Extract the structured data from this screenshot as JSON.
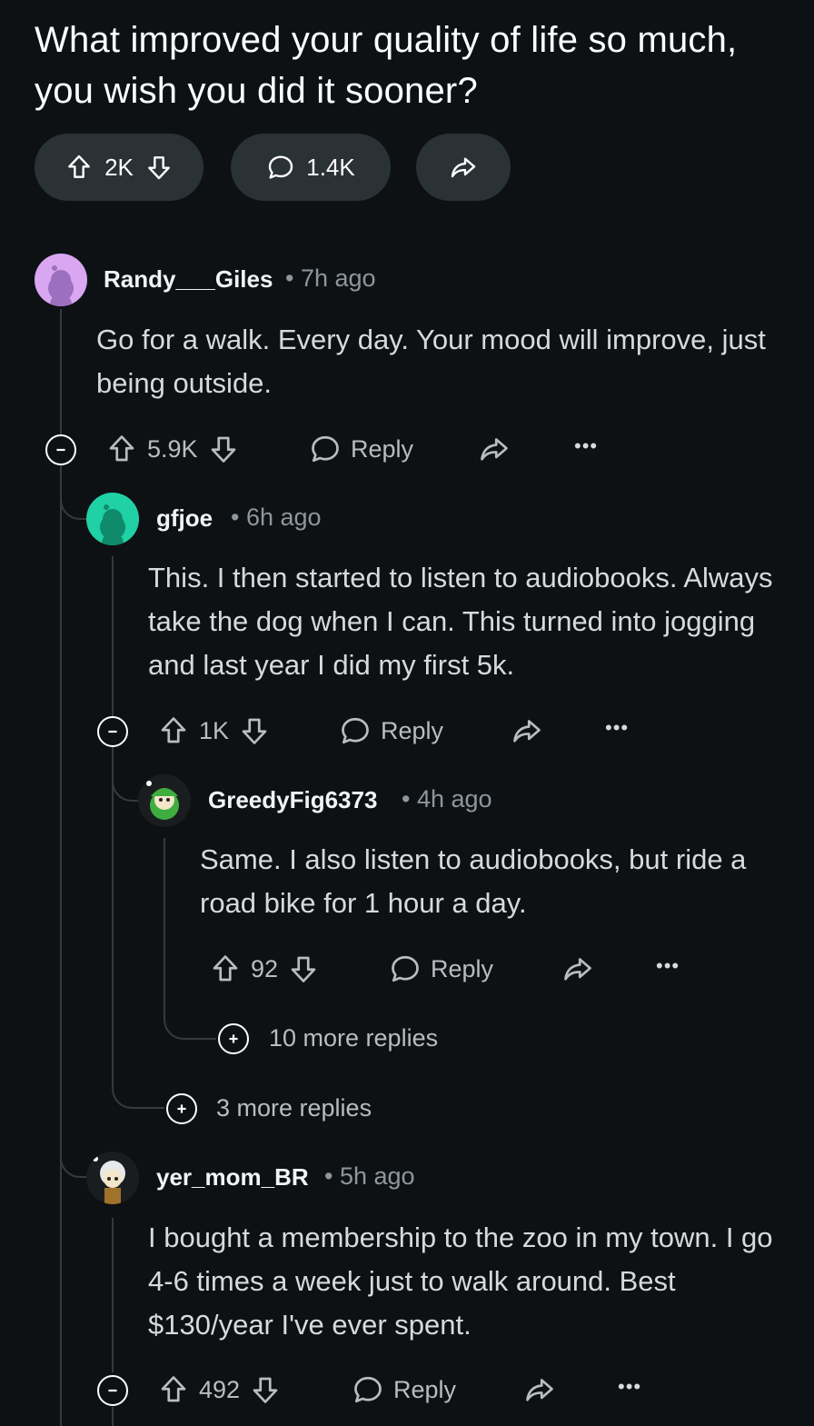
{
  "post": {
    "title": "What improved your quality of life so much, you wish you did it sooner?",
    "votes": "2K",
    "comments_count": "1.4K"
  },
  "comments": [
    {
      "author": "Randy___Giles",
      "time": "7h ago",
      "body": "Go for a walk. Every day. Your mood will improve, just being outside.",
      "votes": "5.9K",
      "reply_label": "Reply"
    },
    {
      "author": "gfjoe",
      "time": "6h ago",
      "body": "This. I then started to listen to audiobooks. Always take the dog when I can. This turned into jogging and last year I did my first 5k.",
      "votes": "1K",
      "reply_label": "Reply"
    },
    {
      "author": "GreedyFig6373",
      "time": "4h ago",
      "body": "Same. I also listen to audiobooks, but ride a road bike for 1 hour a day.",
      "votes": "92",
      "reply_label": "Reply"
    },
    {
      "author": "yer_mom_BR",
      "time": "5h ago",
      "body": "I bought a membership to the zoo in my town. I go 4-6 times a week just to walk around. Best $130/year I've ever spent.",
      "votes": "492",
      "reply_label": "Reply"
    }
  ],
  "more_replies": {
    "greedy": "10 more replies",
    "gfjoe": "3 more replies"
  },
  "separator": "•",
  "overflow": "•••",
  "colors": {
    "background": "#0e1113",
    "pill": "#2a3236",
    "avatar_randy": "#d9a6f2",
    "avatar_gfjoe": "#1fd1a5",
    "thread_line": "#343a3e"
  }
}
